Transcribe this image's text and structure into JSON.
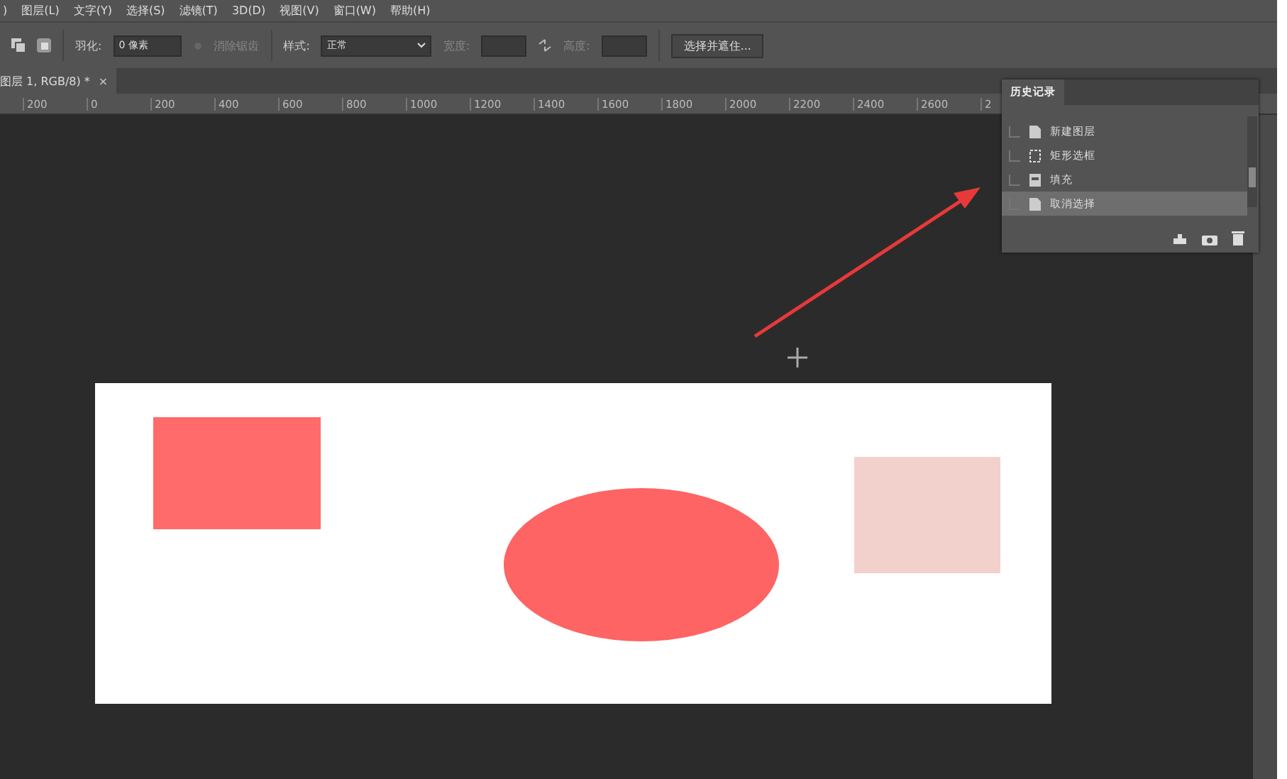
{
  "menu": [
    ")",
    "图层(L)",
    "文字(Y)",
    "选择(S)",
    "滤镜(T)",
    "3D(D)",
    "视图(V)",
    "窗口(W)",
    "帮助(H)"
  ],
  "options": {
    "feather_label": "羽化:",
    "feather_value": "0 像素",
    "antialias_label": "消除锯齿",
    "antialias_disabled": true,
    "style_label": "样式:",
    "style_value": "正常",
    "width_label": "宽度:",
    "height_label": "高度:",
    "mask_button": "选择并遮住..."
  },
  "document_tab": {
    "title": "图层 1, RGB/8) *",
    "close": "×"
  },
  "ruler": [
    "200",
    "0",
    "200",
    "400",
    "600",
    "800",
    "1000",
    "1200",
    "1400",
    "1600",
    "1800",
    "2000",
    "2200",
    "2400",
    "2600",
    "2"
  ],
  "history": {
    "title": "历史记录",
    "items": [
      {
        "label": "新建图层",
        "kind": "document",
        "selected": false
      },
      {
        "label": "矩形选框",
        "kind": "marquee",
        "selected": false
      },
      {
        "label": "填充",
        "kind": "fill",
        "selected": false
      },
      {
        "label": "取消选择",
        "kind": "document",
        "selected": true
      }
    ]
  }
}
